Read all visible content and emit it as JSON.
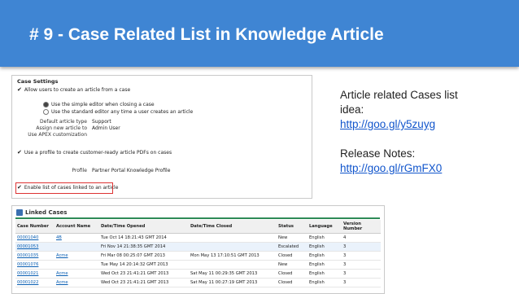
{
  "slide": {
    "title": "# 9 - Case Related List in Knowledge Article"
  },
  "info": {
    "line1": "Article related Cases list",
    "line2": "idea:",
    "idea_link": "http://goo.gl/y5zuyg",
    "release_label": "Release Notes:",
    "release_link": "http://goo.gl/rGmFX0"
  },
  "case_settings": {
    "header": "Case Settings",
    "allow_create": "Allow users to create an article from a case",
    "opt_simple": "Use the simple editor when closing a case",
    "opt_standard": "Use the standard editor any time a user creates an article",
    "default_type_label": "Default article type",
    "default_type_value": "Support",
    "assign_label": "Assign new article to",
    "assign_value": "Admin User",
    "apex_link": "Use APEX customization",
    "pdf_profile": "Use a profile to create customer-ready article PDFs on cases",
    "profile_label": "Profile",
    "profile_value": "Partner Portal Knowledge Profile",
    "enable_linked": "Enable list of cases linked to an article"
  },
  "linked_cases": {
    "title": "Linked Cases",
    "columns": [
      "Case Number",
      "Account Name",
      "Date/Time Opened",
      "Date/Time Closed",
      "Status",
      "Language",
      "Version Number"
    ],
    "rows": [
      [
        "00001040",
        "4B",
        "Tue Oct 14 18:21:43 GMT 2014",
        "",
        "New",
        "English",
        "4"
      ],
      [
        "00001053",
        "",
        "Fri Nov 14 21:38:35 GMT 2014",
        "",
        "Escalated",
        "English",
        "3"
      ],
      [
        "00001035",
        "Acme",
        "Fri Mar 08 00:25:07 GMT 2013",
        "Mon May 13 17:10:51 GMT 2013",
        "Closed",
        "English",
        "3"
      ],
      [
        "00001076",
        "",
        "Tue May 14 20:14:32 GMT 2013",
        "",
        "New",
        "English",
        "3"
      ],
      [
        "00001021",
        "Acme",
        "Wed Oct 23 21:41:21 GMT 2013",
        "Sat May 11 00:29:35 GMT 2013",
        "Closed",
        "English",
        "3"
      ],
      [
        "00001022",
        "Acme",
        "Wed Oct 23 21:41:21 GMT 2013",
        "Sat May 11 00:27:19 GMT 2013",
        "Closed",
        "English",
        "3"
      ]
    ]
  }
}
